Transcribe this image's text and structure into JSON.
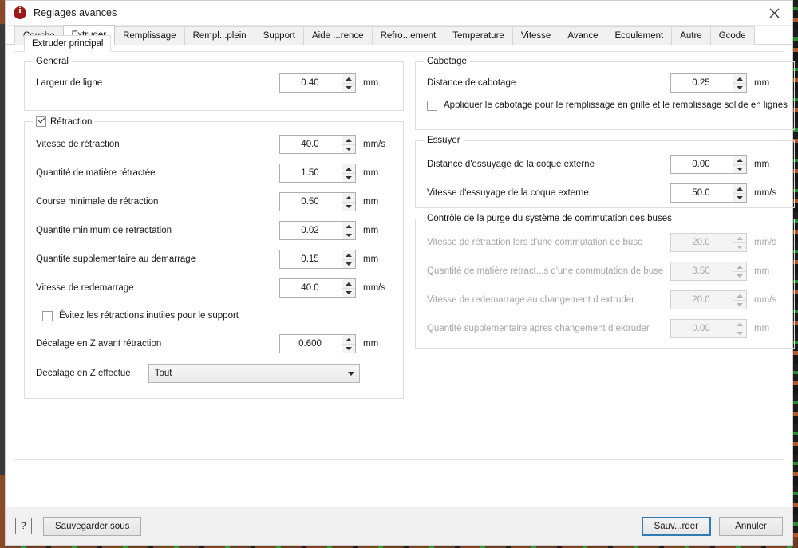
{
  "window": {
    "title": "Reglages avances",
    "icon": "info-circle-icon",
    "close_label": "✕"
  },
  "tabs": [
    {
      "label": "Couche",
      "active": false
    },
    {
      "label": "Extruder",
      "active": true
    },
    {
      "label": "Remplissage",
      "active": false
    },
    {
      "label": "Rempl...plein",
      "active": false
    },
    {
      "label": "Support",
      "active": false
    },
    {
      "label": "Aide ...rence",
      "active": false
    },
    {
      "label": "Refro...ement",
      "active": false
    },
    {
      "label": "Temperature",
      "active": false
    },
    {
      "label": "Vitesse",
      "active": false
    },
    {
      "label": "Avance",
      "active": false
    },
    {
      "label": "Ecoulement",
      "active": false
    },
    {
      "label": "Autre",
      "active": false
    },
    {
      "label": "Gcode",
      "active": false
    }
  ],
  "subtab": {
    "label": "Extruder principal"
  },
  "groups": {
    "general": {
      "legend": "General",
      "fields": [
        {
          "label": "Largeur de ligne",
          "value": "0.40",
          "unit": "mm",
          "disabled": false
        }
      ]
    },
    "retraction": {
      "legend": "Rétraction",
      "checked": true,
      "fields": [
        {
          "label": "Vitesse de rétraction",
          "value": "40.0",
          "unit": "mm/s",
          "disabled": false
        },
        {
          "label": "Quantité de matière rétractée",
          "value": "1.50",
          "unit": "mm",
          "disabled": false
        },
        {
          "label": "Course minimale de rétraction",
          "value": "0.50",
          "unit": "mm",
          "disabled": false
        },
        {
          "label": "Quantite minimum de retractation",
          "value": "0.02",
          "unit": "mm",
          "disabled": false
        },
        {
          "label": "Quantite supplementaire au demarrage",
          "value": "0.15",
          "unit": "mm",
          "disabled": false
        },
        {
          "label": "Vitesse de redemarrage",
          "value": "40.0",
          "unit": "mm/s",
          "disabled": false
        }
      ],
      "checkbox": {
        "label": "Évitez les rétractions inutiles pour le support",
        "checked": false
      },
      "zhop": {
        "label": "Décalage en Z avant rétraction",
        "value": "0.600",
        "unit": "mm",
        "disabled": false
      },
      "zhop_mode": {
        "label": "Décalage en Z effectué",
        "value": "Tout"
      }
    },
    "cabotage": {
      "legend": "Cabotage",
      "fields": [
        {
          "label": "Distance de cabotage",
          "value": "0.25",
          "unit": "mm",
          "disabled": false
        }
      ],
      "checkbox": {
        "label": "Appliquer le cabotage pour le remplissage en grille et le remplissage solide en lignes",
        "checked": false
      }
    },
    "essuyer": {
      "legend": "Essuyer",
      "fields": [
        {
          "label": "Distance d'essuyage de la coque externe",
          "value": "0.00",
          "unit": "mm",
          "disabled": false
        },
        {
          "label": "Vitesse d'essuyage de la coque externe",
          "value": "50.0",
          "unit": "mm/s",
          "disabled": false
        }
      ]
    },
    "purge": {
      "legend": "Contrôle de la purge du système de commutation des buses",
      "fields": [
        {
          "label": "Vitesse de rétraction lors d'une commutation de buse",
          "value": "20.0",
          "unit": "mm/s",
          "disabled": true
        },
        {
          "label": "Quantité de matière rétract...s d'une commutation de buse",
          "value": "3.50",
          "unit": "mm",
          "disabled": true
        },
        {
          "label": "Vitesse de redemarrage au changement d extruder",
          "value": "20.0",
          "unit": "mm/s",
          "disabled": true
        },
        {
          "label": "Quantité supplementaire apres changement d extruder",
          "value": "0.00",
          "unit": "mm",
          "disabled": true
        }
      ]
    }
  },
  "footer": {
    "help_label": "?",
    "save_as_label": "Sauvegarder sous",
    "ok_label": "Sauv...rder",
    "cancel_label": "Annuler"
  },
  "colors": {
    "default_button_border": "#2e7bb5",
    "window_bg": "#ffffff",
    "footer_bg": "#f0f0f0",
    "disabled_text": "#a6a6a6"
  }
}
